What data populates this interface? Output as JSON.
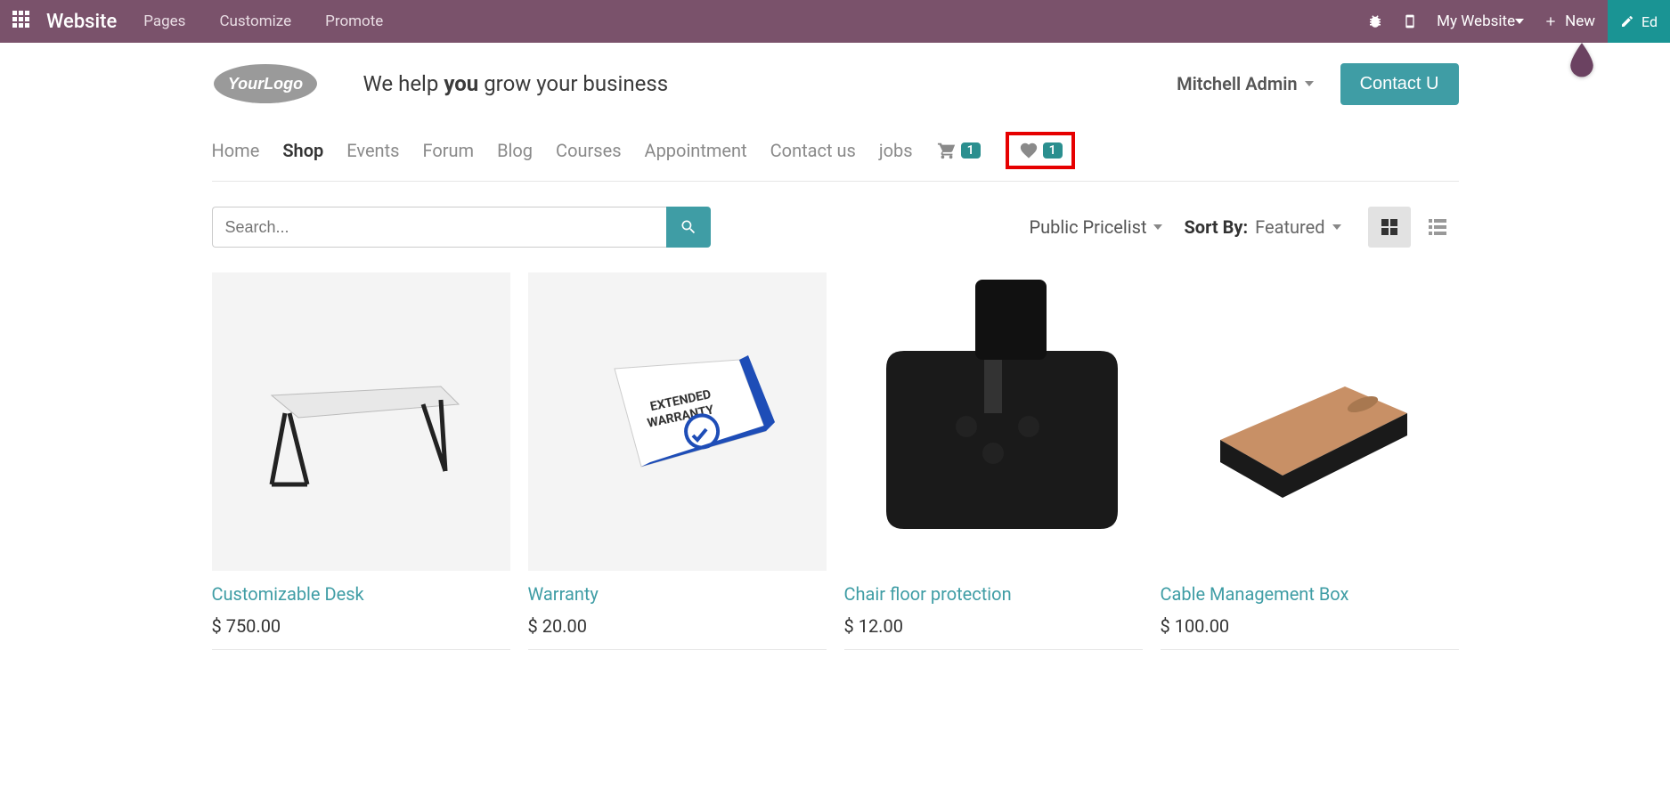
{
  "admin": {
    "app_title": "Website",
    "links": [
      "Pages",
      "Customize",
      "Promote"
    ],
    "my_website": "My Website",
    "new": "New",
    "edit": "Ed"
  },
  "header": {
    "tagline_pre": "We help ",
    "tagline_bold": "you",
    "tagline_post": " grow your business",
    "user": "Mitchell Admin",
    "contact": "Contact U"
  },
  "nav": {
    "items": [
      "Home",
      "Shop",
      "Events",
      "Forum",
      "Blog",
      "Courses",
      "Appointment",
      "Contact us",
      "jobs"
    ],
    "active_index": 1,
    "cart_count": "1",
    "wish_count": "1"
  },
  "toolbar": {
    "search_placeholder": "Search...",
    "pricelist": "Public Pricelist",
    "sort_label": "Sort By:",
    "sort_value": "Featured"
  },
  "products": [
    {
      "name": "Customizable Desk",
      "price": "$ 750.00"
    },
    {
      "name": "Warranty",
      "price": "$ 20.00"
    },
    {
      "name": "Chair floor protection",
      "price": "$ 12.00"
    },
    {
      "name": "Cable Management Box",
      "price": "$ 100.00"
    }
  ]
}
